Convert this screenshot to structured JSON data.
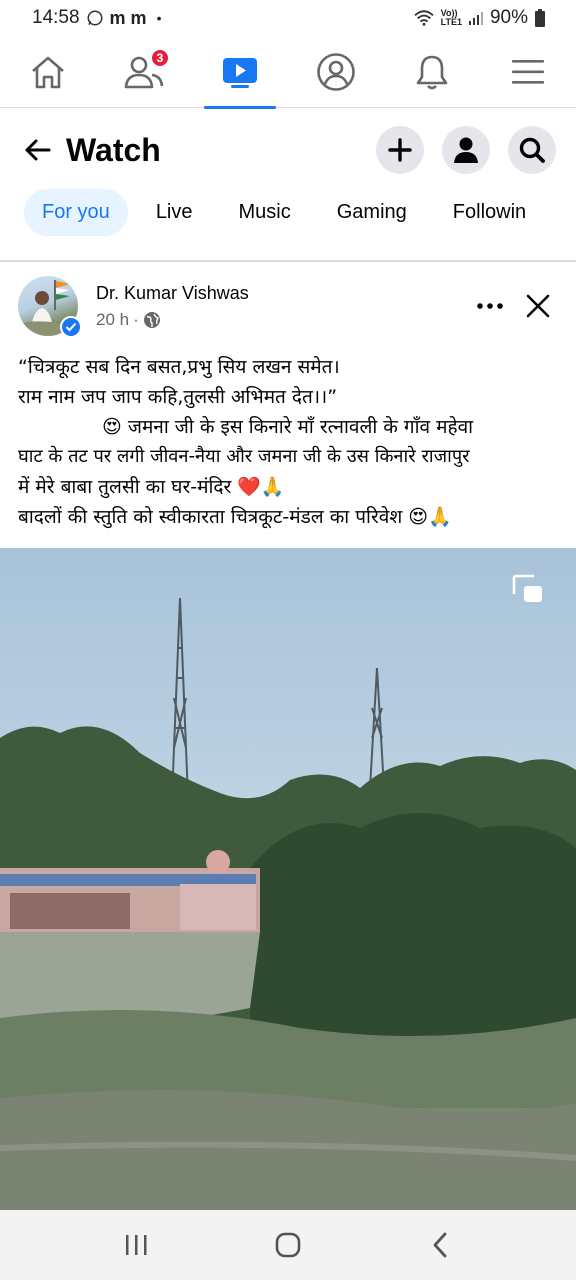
{
  "status_bar": {
    "time": "14:58",
    "carrier_icons": "m m",
    "dot": "•",
    "network_label_top": "Vo))",
    "network_label_bottom": "LTE1",
    "battery": "90%"
  },
  "top_nav": {
    "items": [
      {
        "name": "home",
        "icon": "home-icon"
      },
      {
        "name": "friends",
        "icon": "friends-icon",
        "badge": "3"
      },
      {
        "name": "watch",
        "icon": "watch-icon",
        "active": true
      },
      {
        "name": "profile",
        "icon": "profile-icon"
      },
      {
        "name": "notifications",
        "icon": "bell-icon"
      },
      {
        "name": "menu",
        "icon": "menu-icon"
      }
    ],
    "accent_color": "#1877f2",
    "badge_color": "#e41e3f"
  },
  "header": {
    "title": "Watch"
  },
  "tabs": [
    {
      "label": "For you",
      "active": true
    },
    {
      "label": "Live"
    },
    {
      "label": "Music"
    },
    {
      "label": "Gaming"
    },
    {
      "label": "Followin"
    }
  ],
  "post": {
    "author": "Dr. Kumar Vishwas",
    "time": "20 h",
    "separator": "·",
    "lines": [
      "“चित्रकूट सब दिन बसत,प्रभु सिय लखन समेत।",
      "राम नाम जप जाप कहि,तुलसी अभिमत देत।।”",
      "😍 जमना जी के इस किनारे माँ रत्नावली के गाँव महेवा",
      "घाट के तट पर लगी जीवन-नैया और जमना जी के उस किनारे राजापुर",
      "में मेरे बाबा तुलसी का घर-मंदिर ❤️🙏",
      "बादलों की स्तुति को स्वीकारता चित्रकूट-मंडल का परिवेश 😍🙏"
    ]
  }
}
